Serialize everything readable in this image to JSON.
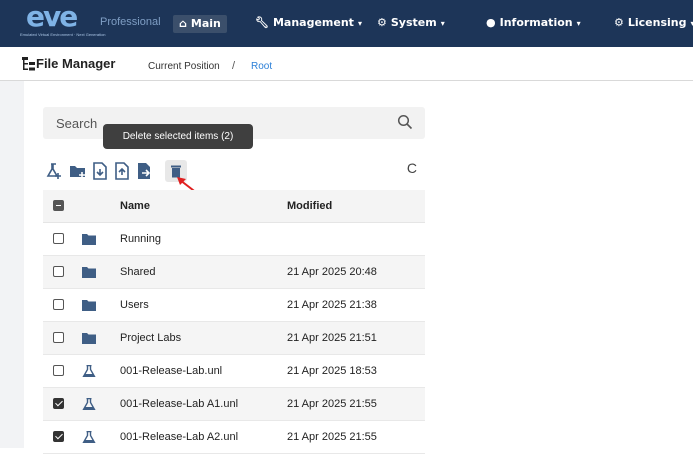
{
  "navbar": {
    "logo_text": "eve",
    "logo_subtitle": "Emulated Virtual Environment · Next Generation",
    "edition": "Professional",
    "items": [
      {
        "label": "Main",
        "icon": "home-icon"
      },
      {
        "label": "Management",
        "icon": "wrench-icon",
        "has_caret": true
      },
      {
        "label": "System",
        "icon": "gear-icon",
        "has_caret": true
      },
      {
        "label": "Information",
        "icon": "info-icon",
        "has_caret": true
      },
      {
        "label": "Licensing",
        "icon": "certificate-icon",
        "has_caret": true
      }
    ],
    "caret": "▾"
  },
  "breadcrumb": {
    "title": "File Manager",
    "position_label": "Current Position",
    "separator": "/",
    "current": "Root"
  },
  "search": {
    "placeholder": "Search"
  },
  "tooltip": {
    "text": "Delete selected items (2)"
  },
  "toolbar": {
    "buttons": [
      "add-lab-icon",
      "new-folder-icon",
      "import-icon",
      "export-icon",
      "move-icon",
      "delete-icon"
    ],
    "refresh_glyph": "C"
  },
  "table": {
    "headers": {
      "name": "Name",
      "modified": "Modified"
    },
    "rows": [
      {
        "name": "Running",
        "modified": "",
        "type": "folder",
        "checked": false
      },
      {
        "name": "Shared",
        "modified": "21 Apr 2025 20:48",
        "type": "folder",
        "checked": false
      },
      {
        "name": "Users",
        "modified": "21 Apr 2025 21:38",
        "type": "folder",
        "checked": false
      },
      {
        "name": "Project Labs",
        "modified": "21 Apr 2025 21:51",
        "type": "folder",
        "checked": false
      },
      {
        "name": "001-Release-Lab.unl",
        "modified": "21 Apr 2025 18:53",
        "type": "lab",
        "checked": false
      },
      {
        "name": "001-Release-Lab A1.unl",
        "modified": "21 Apr 2025 21:55",
        "type": "lab",
        "checked": true
      },
      {
        "name": "001-Release-Lab A2.unl",
        "modified": "21 Apr 2025 21:55",
        "type": "lab",
        "checked": true
      }
    ]
  },
  "colors": {
    "navbar": "#1d3558",
    "folder": "#3f5e85",
    "link": "#2d80d8",
    "annotation_arrow": "#e02020"
  }
}
